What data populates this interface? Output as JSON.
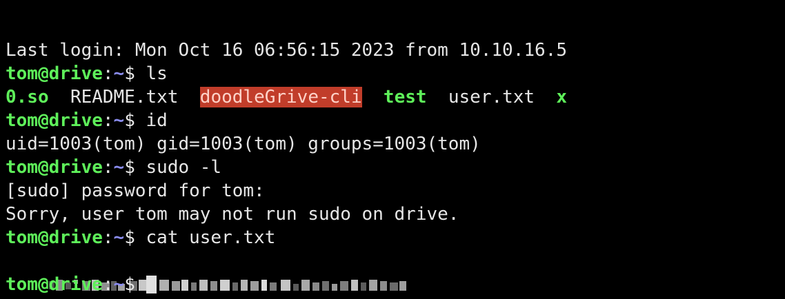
{
  "terminal": {
    "last_login": "Last login: Mon Oct 16 06:56:15 2023 from 10.10.16.5",
    "prompt_user": "tom@drive",
    "prompt_sep": ":",
    "prompt_path": "~",
    "prompt_dollar": "$ ",
    "lines": {
      "cmd1": "ls",
      "ls_items": [
        "0.so",
        "README.txt",
        "doodleGrive-cli",
        "test",
        "user.txt",
        "x"
      ],
      "cmd2": "id",
      "id_output": "uid=1003(tom) gid=1003(tom) groups=1003(tom)",
      "cmd3": "sudo -l",
      "sudo_prompt": "[sudo] password for tom:",
      "sudo_error": "Sorry, user tom may not run sudo on drive.",
      "cmd4": "cat user.txt"
    },
    "colors": {
      "background": "#000000",
      "prompt_user": "#5ef05a",
      "prompt_path": "#8a8cf0",
      "highlight_dir": "#c13d2a"
    }
  }
}
